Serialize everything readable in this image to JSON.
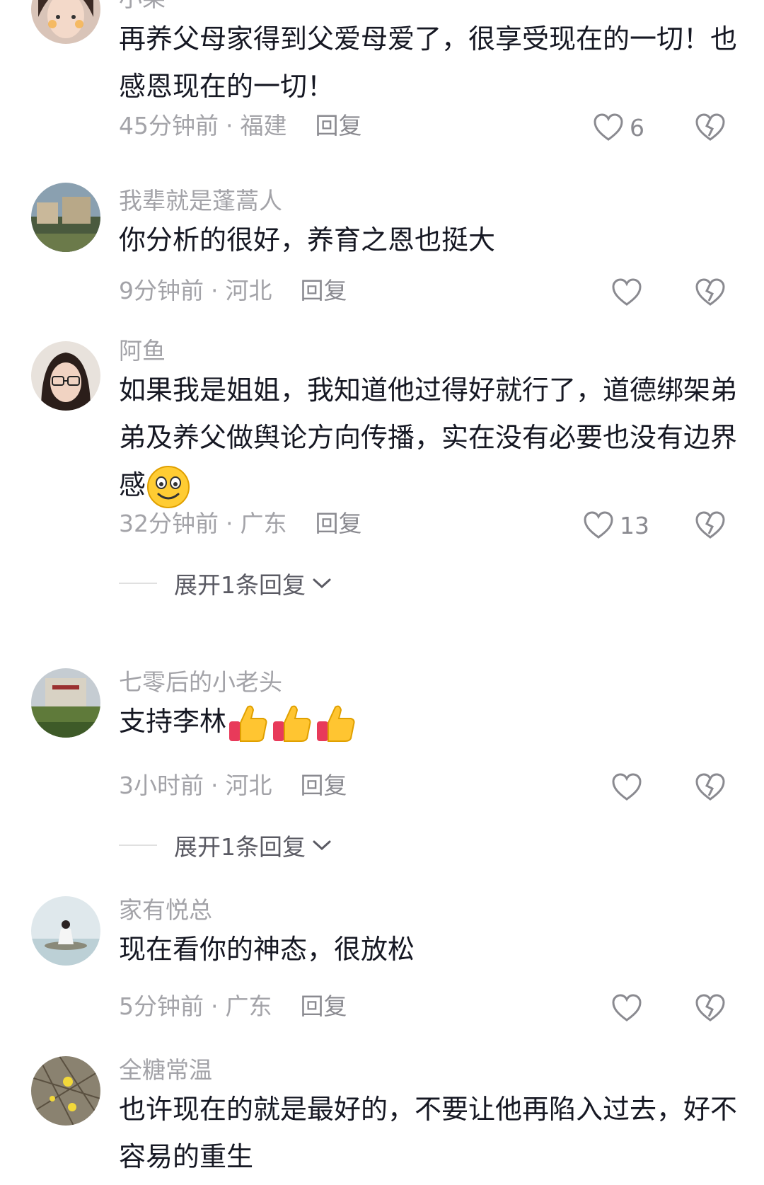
{
  "comments": [
    {
      "username": "小果",
      "text": "再养父母家得到父爱母爱了，很享受现在的一切！也感恩现在的一切！",
      "time": "45分钟前",
      "location": "福建",
      "reply": "回复",
      "likes": "6"
    },
    {
      "username": "我辈就是蓬蒿人",
      "text": "你分析的很好，养育之恩也挺大",
      "time": "9分钟前",
      "location": "河北",
      "reply": "回复",
      "likes": ""
    },
    {
      "username": "阿鱼",
      "text": "如果我是姐姐，我知道他过得好就行了，道德绑架弟弟及养父做舆论方向传播，实在没有必要也没有边界感",
      "time": "32分钟前",
      "location": "广东",
      "reply": "回复",
      "likes": "13",
      "expand": "展开1条回复"
    },
    {
      "username": "七零后的小老头",
      "text": "支持李林",
      "time": "3小时前",
      "location": "河北",
      "reply": "回复",
      "likes": "",
      "expand": "展开1条回复"
    },
    {
      "username": "家有悦总",
      "text": "现在看你的神态，很放松",
      "time": "5分钟前",
      "location": "广东",
      "reply": "回复",
      "likes": ""
    },
    {
      "username": "全糖常温",
      "text": "也许现在的就是最好的，不要让他再陷入过去，好不容易的重生",
      "time": "",
      "location": "",
      "reply": "",
      "likes": ""
    }
  ],
  "icons": {
    "like": "heart-outline-icon",
    "dislike": "broken-heart-icon",
    "expand": "chevron-down-icon",
    "emoji_smile": "smiling-face-emoji",
    "emoji_thumbs": "thumbs-up-emoji"
  }
}
